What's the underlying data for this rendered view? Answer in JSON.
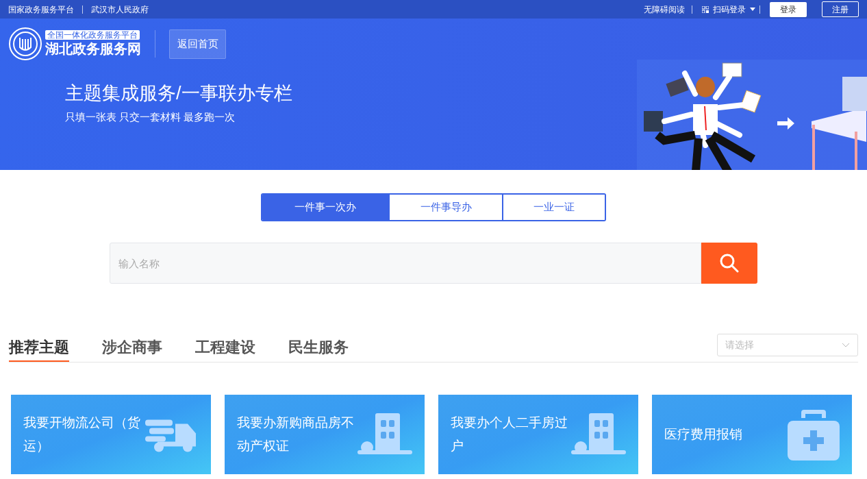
{
  "top_bar": {
    "links": [
      "国家政务服务平台",
      "武汉市人民政府"
    ],
    "accessibility": "无障碍阅读",
    "qr_login": "扫码登录",
    "login": "登录",
    "register": "注册"
  },
  "header": {
    "logo_subtitle": "全国一体化政务服务平台",
    "logo_title": "湖北政务服务网",
    "home_button": "返回首页"
  },
  "banner": {
    "title": "主题集成服务/一事联办专栏",
    "subtitle": "只填一张表 只交一套材料 最多跑一次"
  },
  "mode_tabs": [
    {
      "label": "一件事一次办",
      "selected": true
    },
    {
      "label": "一件事导办",
      "selected": false
    },
    {
      "label": "一业一证",
      "selected": false
    }
  ],
  "search": {
    "placeholder": "输入名称"
  },
  "category_tabs": [
    {
      "label": "推荐主题",
      "selected": true
    },
    {
      "label": "涉企商事",
      "selected": false
    },
    {
      "label": "工程建设",
      "selected": false
    },
    {
      "label": "民生服务",
      "selected": false
    }
  ],
  "filter": {
    "placeholder": "请选择"
  },
  "cards": [
    {
      "title": "我要开物流公司（货运）",
      "kind": "truck"
    },
    {
      "title": "我要办新购商品房不动产权证",
      "kind": "building"
    },
    {
      "title": "我要办个人二手房过户",
      "kind": "building"
    },
    {
      "title": "医疗费用报销",
      "kind": "medkit"
    }
  ]
}
